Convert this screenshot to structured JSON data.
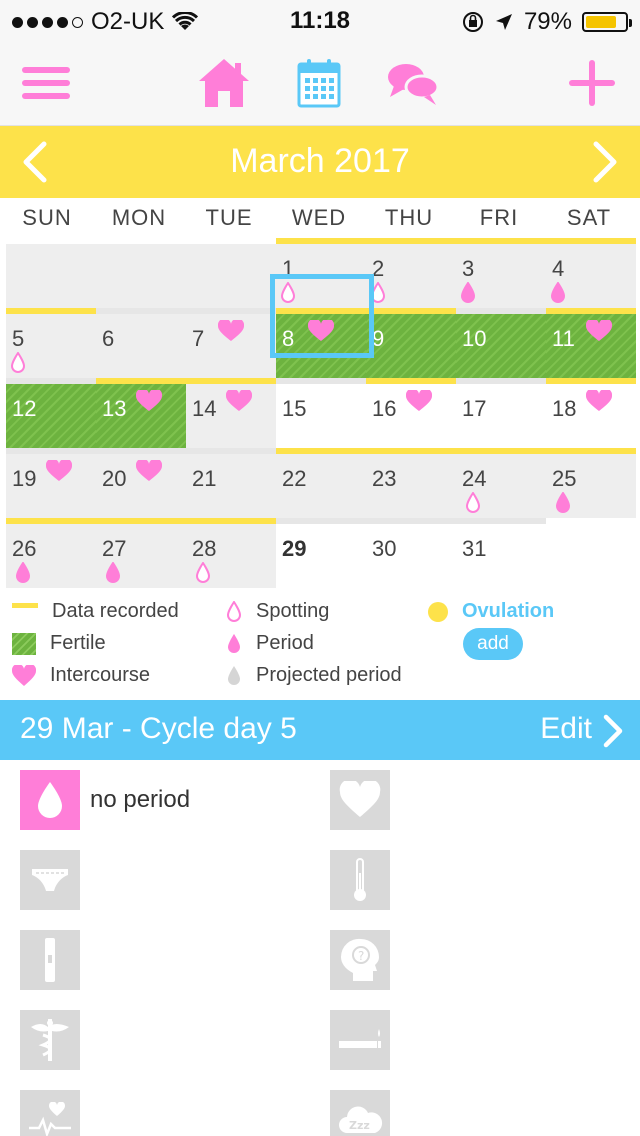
{
  "status_bar": {
    "carrier": "O2-UK",
    "time": "11:18",
    "battery": "79%",
    "battery_level": 0.79,
    "signal_bars": 4
  },
  "nav": {
    "menu_icon": "hamburger-menu-icon",
    "home_icon": "home-icon",
    "calendar_icon": "calendar-icon",
    "chat_icon": "chat-bubbles-icon",
    "add_icon": "plus-icon"
  },
  "calendar": {
    "month_title": "March 2017",
    "weekdays": [
      "SUN",
      "MON",
      "TUE",
      "WED",
      "THU",
      "FRI",
      "SAT"
    ],
    "weeks": [
      [
        {
          "day": "",
          "bar": "none",
          "bg": "grey"
        },
        {
          "day": "",
          "bar": "none",
          "bg": "grey"
        },
        {
          "day": "",
          "bar": "none",
          "bg": "grey"
        },
        {
          "day": "1",
          "bar": "yellow",
          "bg": "grey",
          "drop": "spotting"
        },
        {
          "day": "2",
          "bar": "yellow",
          "bg": "grey",
          "drop": "spotting"
        },
        {
          "day": "3",
          "bar": "yellow",
          "bg": "grey",
          "drop": "period"
        },
        {
          "day": "4",
          "bar": "yellow",
          "bg": "grey",
          "drop": "period"
        }
      ],
      [
        {
          "day": "5",
          "bar": "yellow",
          "bg": "grey",
          "drop": "spotting"
        },
        {
          "day": "6",
          "bar": "grey",
          "bg": "grey"
        },
        {
          "day": "7",
          "bar": "grey",
          "bg": "grey",
          "heart": true
        },
        {
          "day": "8",
          "bar": "yellow",
          "bg": "fertile",
          "heart": true
        },
        {
          "day": "9",
          "bar": "yellow",
          "bg": "fertile"
        },
        {
          "day": "10",
          "bar": "grey",
          "bg": "fertile"
        },
        {
          "day": "11",
          "bar": "yellow",
          "bg": "fertile",
          "heart": true
        }
      ],
      [
        {
          "day": "12",
          "bar": "grey",
          "bg": "fertile"
        },
        {
          "day": "13",
          "bar": "yellow",
          "bg": "fertile",
          "heart": true
        },
        {
          "day": "14",
          "bar": "yellow",
          "bg": "grey",
          "heart": true
        },
        {
          "day": "15",
          "bar": "grey",
          "bg": "plain"
        },
        {
          "day": "16",
          "bar": "yellow",
          "bg": "plain",
          "heart": true
        },
        {
          "day": "17",
          "bar": "grey",
          "bg": "plain"
        },
        {
          "day": "18",
          "bar": "yellow",
          "bg": "plain",
          "heart": true
        }
      ],
      [
        {
          "day": "19",
          "bar": "grey",
          "bg": "grey",
          "heart": true
        },
        {
          "day": "20",
          "bar": "grey",
          "bg": "grey",
          "heart": true
        },
        {
          "day": "21",
          "bar": "grey",
          "bg": "grey"
        },
        {
          "day": "22",
          "bar": "yellow",
          "bg": "grey"
        },
        {
          "day": "23",
          "bar": "yellow",
          "bg": "grey"
        },
        {
          "day": "24",
          "bar": "yellow",
          "bg": "grey",
          "drop": "spotting"
        },
        {
          "day": "25",
          "bar": "yellow",
          "bg": "grey",
          "drop": "period"
        }
      ],
      [
        {
          "day": "26",
          "bar": "yellow",
          "bg": "grey",
          "drop": "period"
        },
        {
          "day": "27",
          "bar": "yellow",
          "bg": "grey",
          "drop": "period"
        },
        {
          "day": "28",
          "bar": "yellow",
          "bg": "grey",
          "drop": "spotting"
        },
        {
          "day": "29",
          "bar": "grey",
          "bg": "plain",
          "today": true
        },
        {
          "day": "30",
          "bar": "grey",
          "bg": "plain"
        },
        {
          "day": "31",
          "bar": "grey",
          "bg": "plain"
        },
        {
          "day": "",
          "bar": "none",
          "bg": "plain"
        }
      ]
    ]
  },
  "legend": {
    "data_recorded": "Data recorded",
    "fertile": "Fertile",
    "intercourse": "Intercourse",
    "spotting": "Spotting",
    "period": "Period",
    "projected_period": "Projected period",
    "ovulation": "Ovulation",
    "add": "add"
  },
  "cycle": {
    "title": "29 Mar  - Cycle day 5",
    "edit": "Edit"
  },
  "tiles": {
    "period_label": "no period",
    "left": [
      "period-drop-icon",
      "underwear-icon",
      "ovulation-test-icon",
      "medicine-icon",
      "heart-rate-icon"
    ],
    "right": [
      "heart-icon",
      "thermometer-icon",
      "mood-head-icon",
      "smoking-icon",
      "sleep-cloud-icon"
    ]
  },
  "colors": {
    "pink": "#ff7ed8",
    "yellow": "#fde24a",
    "blue": "#5ac8f7",
    "green": "#6db33f",
    "grey": "#d9d9d9"
  }
}
